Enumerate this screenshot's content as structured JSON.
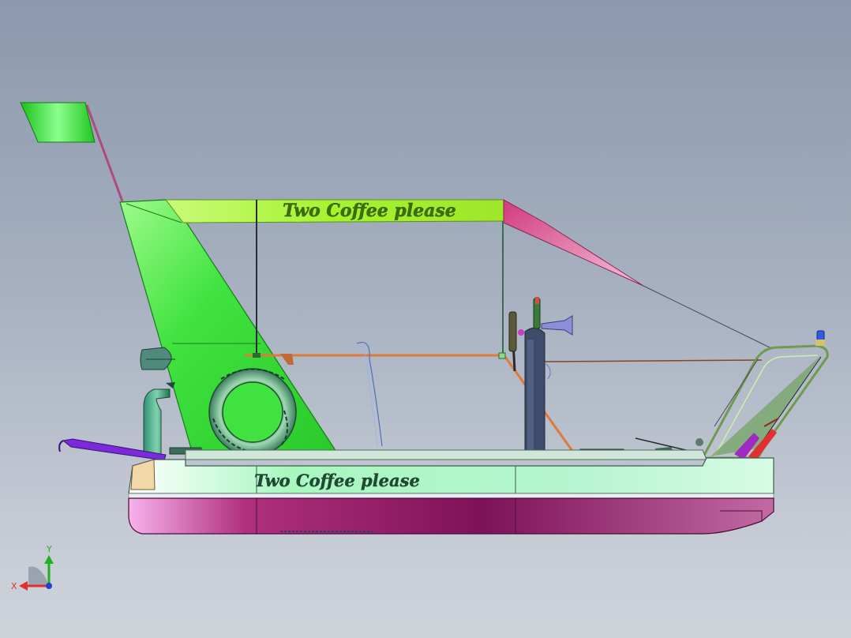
{
  "canopy_label": "Two Coffee please",
  "hull_label": "Two Coffee please",
  "triad": {
    "x_label": "X",
    "y_label": "Y"
  },
  "colors": {
    "canopy": "#a6f22e",
    "hull_top": "#cdfbdc",
    "hull_bottom": "#8a1a5e",
    "mast_panel": "#3fe23f",
    "flag": "#2fd42f",
    "background": "#a6b0c0"
  }
}
